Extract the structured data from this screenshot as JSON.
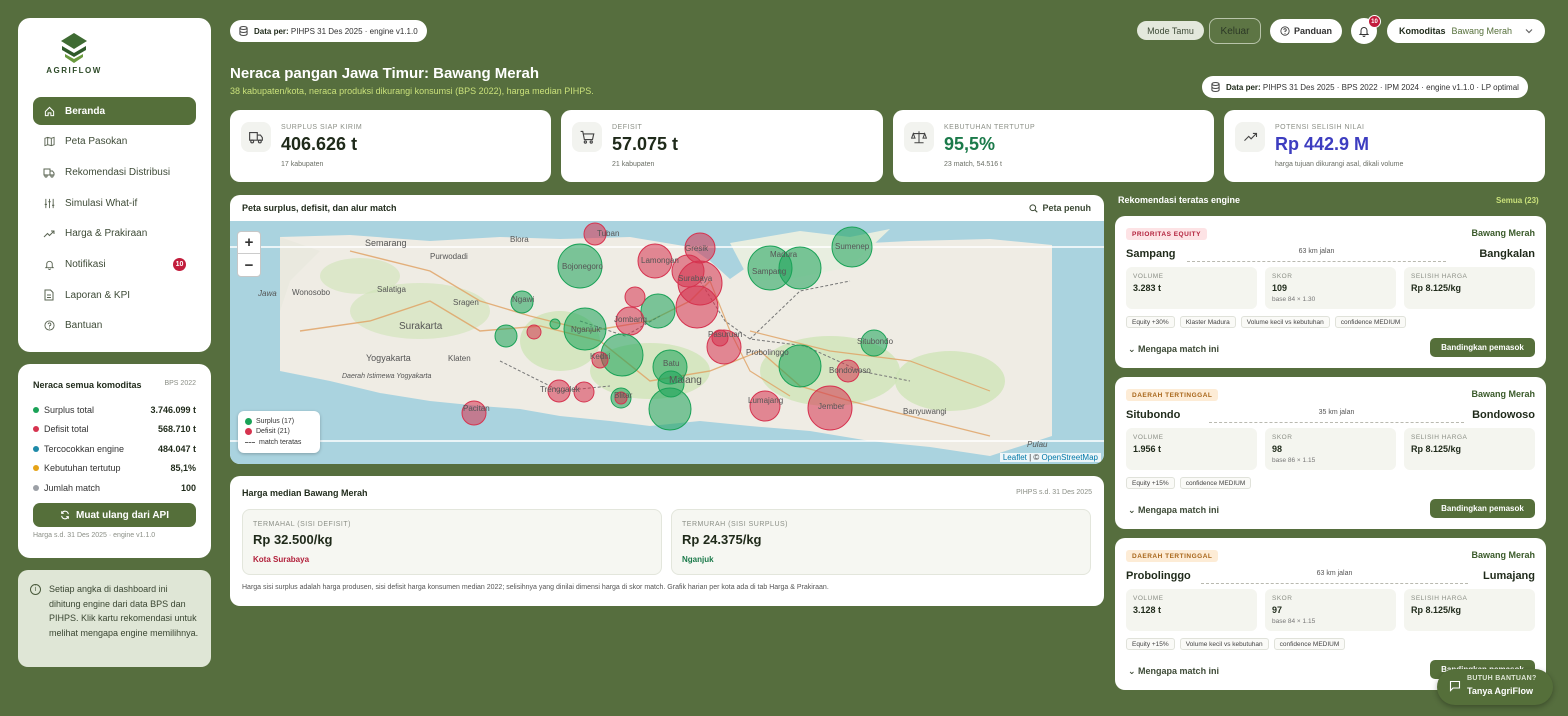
{
  "brand": {
    "name": "AGRIFLOW"
  },
  "sidebar": {
    "items": [
      {
        "label": "Beranda"
      },
      {
        "label": "Peta Pasokan"
      },
      {
        "label": "Rekomendasi Distribusi"
      },
      {
        "label": "Simulasi What-if"
      },
      {
        "label": "Harga & Prakiraan"
      },
      {
        "label": "Notifikasi",
        "badge": "10"
      },
      {
        "label": "Laporan & KPI"
      },
      {
        "label": "Bantuan"
      }
    ]
  },
  "balance": {
    "title": "Neraca semua komoditas",
    "source": "BPS 2022",
    "rows": [
      {
        "label": "Surplus total",
        "value": "3.746.099 t",
        "color": "#1aa257"
      },
      {
        "label": "Defisit total",
        "value": "568.710 t",
        "color": "#d6334f"
      },
      {
        "label": "Tercocokkan engine",
        "value": "484.047 t",
        "color": "#1e8aa8"
      },
      {
        "label": "Kebutuhan tertutup",
        "value": "85,1%",
        "color": "#e6a317"
      },
      {
        "label": "Jumlah match",
        "value": "100",
        "color": "#9ca0a6"
      }
    ],
    "reload_label": "Muat ulang dari API",
    "note": "Harga s.d. 31 Des 2025 · engine v1.1.0"
  },
  "info": {
    "text": "Setiap angka di dashboard ini dihitung engine dari data BPS dan PIHPS. Klik kartu rekomendasi untuk melihat mengapa engine memilihnya."
  },
  "topbar": {
    "data_label": "Data per:",
    "data_value": "PIHPS 31 Des 2025 · engine v1.1.0",
    "mode": "Mode Tamu",
    "logout": "Keluar",
    "guide": "Panduan",
    "notif_count": "10",
    "komoditas_label": "Komoditas",
    "komoditas_value": "Bawang Merah"
  },
  "page": {
    "title": "Neraca pangan Jawa Timur: Bawang Merah",
    "subtitle": "38 kabupaten/kota, neraca produksi dikurangi konsumsi (BPS 2022), harga median PIHPS.",
    "data_label": "Data per:",
    "data_value": "PIHPS 31 Des 2025 · BPS 2022 · IPM 2024 · engine v1.1.0 · LP optimal"
  },
  "kpis": [
    {
      "label": "SURPLUS SIAP KIRIM",
      "value": "406.626 t",
      "sub": "17 kabupaten",
      "color": "#1f2a1a"
    },
    {
      "label": "DEFISIT",
      "value": "57.075 t",
      "sub": "21 kabupaten",
      "color": "#1f2a1a"
    },
    {
      "label": "KEBUTUHAN TERTUTUP",
      "value": "95,5%",
      "sub": "23 match, 54.516 t",
      "color": "#1b7a4a"
    },
    {
      "label": "POTENSI SELISIH NILAI",
      "value": "Rp 442.9 M",
      "sub": "harga tujuan dikurangi asal, dikali volume",
      "color": "#3d3dc0"
    }
  ],
  "map": {
    "title": "Peta surplus, defisit, dan alur match",
    "full_label": "Peta penuh",
    "zoom_in": "+",
    "zoom_out": "−",
    "legend": {
      "surplus": "Surplus (17)",
      "deficit": "Defisit (21)",
      "match": "match teratas"
    },
    "attribution_leaflet": "Leaflet",
    "attribution_sep": " | © ",
    "attribution_osm": "OpenStreetMap",
    "surplus_color": "#1aa257",
    "deficit_color": "#d6334f",
    "labels": [
      "Semarang",
      "Blora",
      "Tuban",
      "Purwodadi",
      "Bojonegoro",
      "Lamongan",
      "Gresik",
      "Madura",
      "Sumenep",
      "Sampang",
      "Surabaya",
      "Wonosobo",
      "Salatiga",
      "Sragen",
      "Ngawi",
      "Surakarta",
      "Nganjuk",
      "Jombang",
      "Pasuruan",
      "Probolinggo",
      "Situbondo",
      "Yogyakarta",
      "Klaten",
      "Kediri",
      "Batu",
      "Malang",
      "Bondowoso",
      "Trenggalek",
      "Blitar",
      "Lumajang",
      "Jember",
      "Pacitan",
      "Banyuwangi",
      "Pulau",
      "Jawa",
      "Daerah Istimewa Yogyakarta"
    ]
  },
  "price": {
    "title": "Harga median Bawang Merah",
    "source": "PIHPS s.d. 31 Des 2025",
    "high": {
      "label": "TERMAHAL (SISI DEFISIT)",
      "value": "Rp 32.500/kg",
      "city": "Kota Surabaya"
    },
    "low": {
      "label": "TERMURAH (SISI SURPLUS)",
      "value": "Rp 24.375/kg",
      "city": "Nganjuk"
    },
    "note": "Harga sisi surplus adalah harga produsen, sisi defisit harga konsumen median 2022; selisihnya yang dinilai dimensi harga di skor match. Grafik harian per kota ada di tab Harga & Prakiraan."
  },
  "recs": {
    "title": "Rekomendasi teratas engine",
    "all_label": "Semua (23)",
    "why_label": "Mengapa match ini",
    "compare_label": "Bandingkan pemasok",
    "stat_labels": {
      "volume": "VOLUME",
      "score": "SKOR",
      "price": "SELISIH HARGA"
    },
    "cards": [
      {
        "tag": "PRIORITAS EQUITY",
        "komoditas": "Bawang Merah",
        "from": "Sampang",
        "to": "Bangkalan",
        "distance": "63 km jalan",
        "volume": "3.283 t",
        "score": "109",
        "score_base": "base 84 × 1.30",
        "price_diff": "Rp 8.125/kg",
        "chips": [
          "Equity +30%",
          "Klaster Madura",
          "Volume kecil vs kebutuhan",
          "confidence MEDIUM"
        ]
      },
      {
        "tag": "DAERAH TERTINGGAL",
        "komoditas": "Bawang Merah",
        "from": "Situbondo",
        "to": "Bondowoso",
        "distance": "35 km jalan",
        "volume": "1.956 t",
        "score": "98",
        "score_base": "base 86 × 1.15",
        "price_diff": "Rp 8.125/kg",
        "chips": [
          "Equity +15%",
          "confidence MEDIUM"
        ]
      },
      {
        "tag": "DAERAH TERTINGGAL",
        "komoditas": "Bawang Merah",
        "from": "Probolinggo",
        "to": "Lumajang",
        "distance": "63 km jalan",
        "volume": "3.128 t",
        "score": "97",
        "score_base": "base 84 × 1.15",
        "price_diff": "Rp 8.125/kg",
        "chips": [
          "Equity +15%",
          "Volume kecil vs kebutuhan",
          "confidence MEDIUM"
        ]
      }
    ]
  },
  "help": {
    "line1": "BUTUH BANTUAN?",
    "line2": "Tanya AgriFlow"
  }
}
